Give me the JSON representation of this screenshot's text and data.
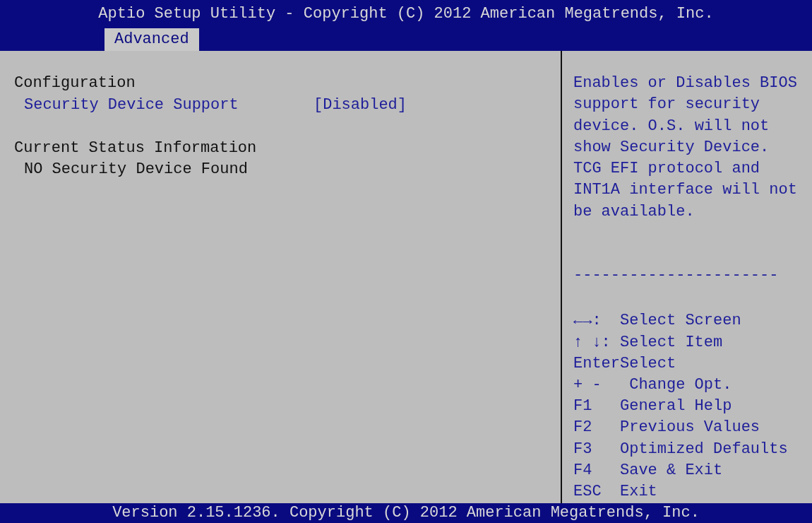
{
  "window": {
    "title": "Aptio Setup Utility - Copyright (C) 2012 American Megatrends, Inc."
  },
  "tabs": [
    {
      "label": "Advanced",
      "selected": true
    }
  ],
  "settings": [
    {
      "kind": "heading",
      "label": "Configuration"
    },
    {
      "kind": "option",
      "label": "Security Device Support",
      "value": "[Disabled]"
    },
    {
      "kind": "spacer"
    },
    {
      "kind": "heading",
      "label": "Current Status Information"
    },
    {
      "kind": "info",
      "label": "NO Security Device Found"
    }
  ],
  "help": {
    "lines": [
      "Enables or Disables BIOS",
      "support for security",
      "device. O.S. will not",
      "show Security Device.",
      "TCG EFI protocol and",
      "INT1A interface will not",
      "be available."
    ],
    "separator": "----------------------"
  },
  "keys": [
    {
      "key": "←→:",
      "action": "Select Screen"
    },
    {
      "key": "↑ ↓:",
      "action": "Select Item"
    },
    {
      "key": "Enter",
      "action": "Select"
    },
    {
      "key": "+ -",
      "action": " Change Opt."
    },
    {
      "key": "F1",
      "action": "General Help"
    },
    {
      "key": "F2",
      "action": "Previous Values"
    },
    {
      "key": "F3",
      "action": "Optimized Defaults"
    },
    {
      "key": "F4",
      "action": "Save & Exit"
    },
    {
      "key": "ESC",
      "action": "Exit"
    }
  ],
  "status_bar": "Version 2.15.1236. Copyright (C) 2012 American Megatrends, Inc."
}
